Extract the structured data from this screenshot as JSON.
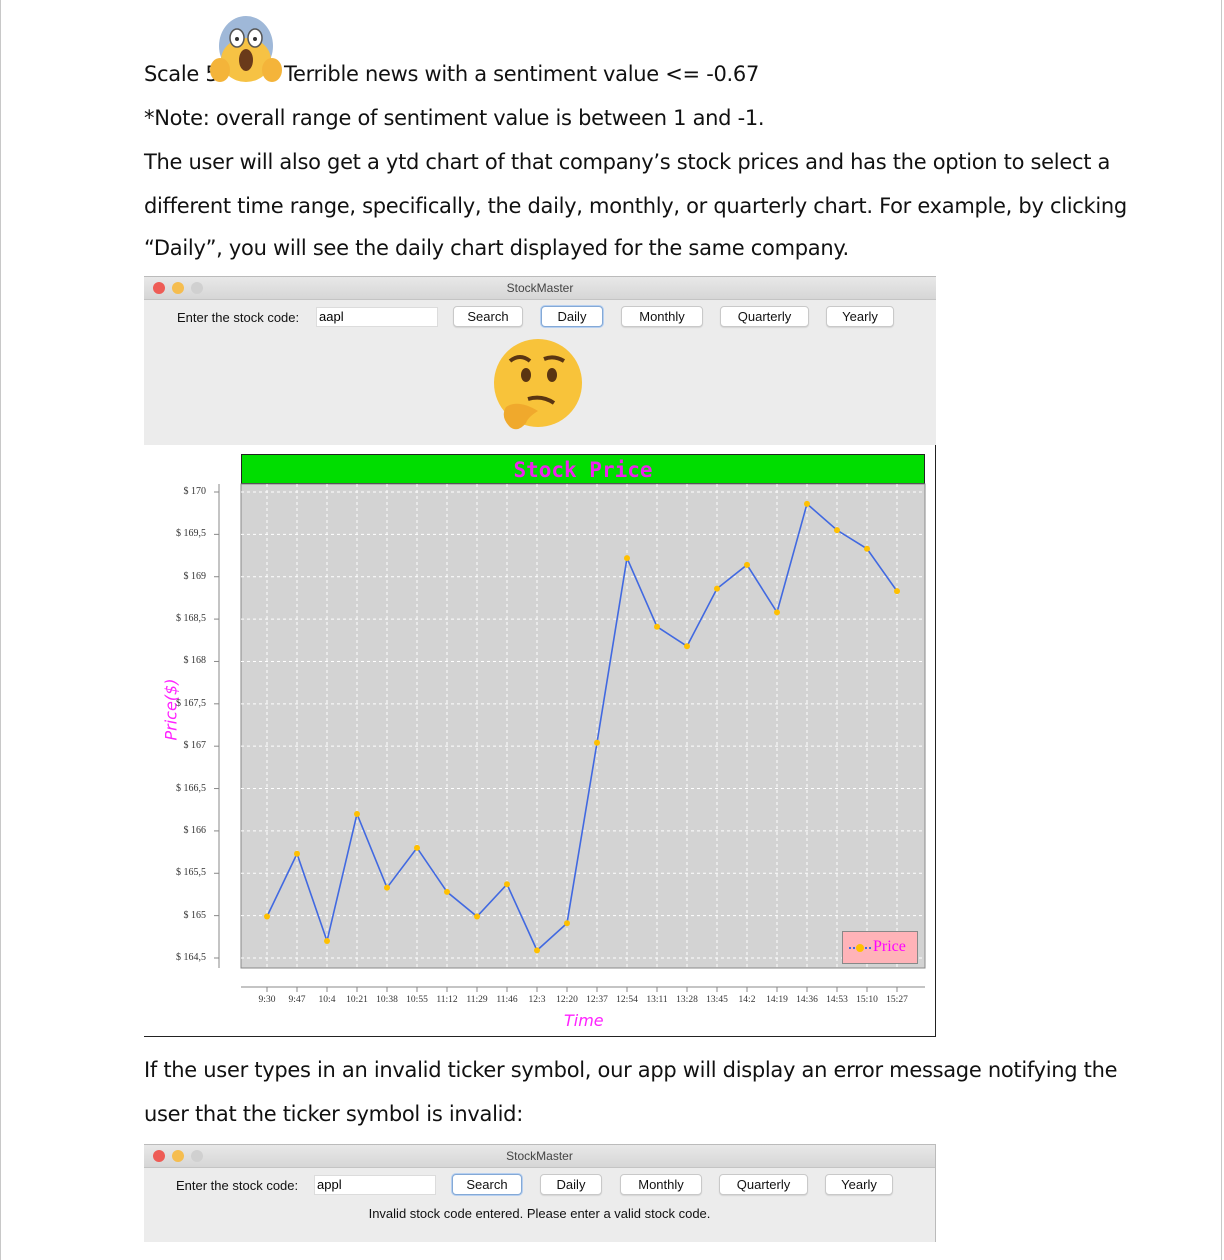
{
  "document": {
    "line1_prefix": "Scale 5",
    "line1_suffix": "Terrible news with a sentiment value <= -0.67",
    "line1_emoji": "face-screaming-in-fear",
    "line2": "*Note: overall range of sentiment value is between 1 and -1.",
    "line3": "The user will also get a ytd chart of that company’s stock prices and has the option to select a",
    "line4": "different time range, specifically, the daily, monthly, or quarterly chart. For example, by clicking",
    "line5": "“Daily”, you will see the daily chart displayed for the same company.",
    "line6": "If the user types in an invalid ticker symbol, our app will display an error message notifying the",
    "line7": "user that the ticker symbol is invalid:"
  },
  "window1": {
    "title": "StockMaster",
    "prompt_label": "Enter the stock code:",
    "stock_code_value": "aapl",
    "buttons": {
      "search": "Search",
      "daily": "Daily",
      "monthly": "Monthly",
      "quarterly": "Quarterly",
      "yearly": "Yearly"
    },
    "focused_button": "Daily",
    "emoji": "thinking-face"
  },
  "window2": {
    "title": "StockMaster",
    "prompt_label": "Enter the stock code:",
    "stock_code_value": "appl",
    "buttons": {
      "search": "Search",
      "daily": "Daily",
      "monthly": "Monthly",
      "quarterly": "Quarterly",
      "yearly": "Yearly"
    },
    "focused_button": "Search",
    "error_message": "Invalid stock code entered. Please enter a valid stock code."
  },
  "colors": {
    "title_bar": "#00dd00",
    "title_text": "#ee22ee",
    "plot_bg": "#d3d3d3",
    "line": "#4169e1",
    "marker": "#ffc000",
    "legend_bg": "#ffb3b8",
    "axis_label": "#ff22ff"
  },
  "chart_data": {
    "type": "line",
    "title": "Stock Price",
    "xlabel": "Time",
    "ylabel": "Price($)",
    "ylim": [
      164.5,
      170
    ],
    "grid": true,
    "legend_position": "bottom-right",
    "yticks": [
      "$ 170",
      "$ 169,5",
      "$ 169",
      "$ 168,5",
      "$ 168",
      "$ 167,5",
      "$ 167",
      "$ 166,5",
      "$ 166",
      "$ 165,5",
      "$ 165",
      "$ 164,5"
    ],
    "ytick_values": [
      170,
      169.5,
      169,
      168.5,
      168,
      167.5,
      167,
      166.5,
      166,
      165.5,
      165,
      164.5
    ],
    "xticks": [
      "9:30",
      "9:47",
      "10:4",
      "10:21",
      "10:38",
      "10:55",
      "11:12",
      "11:29",
      "11:46",
      "12:3",
      "12:20",
      "12:37",
      "12:54",
      "13:11",
      "13:28",
      "13:45",
      "14:2",
      "14:19",
      "14:36",
      "14:53",
      "15:10",
      "15:27"
    ],
    "series": [
      {
        "name": "Price",
        "values": [
          164.99,
          165.73,
          164.7,
          166.2,
          165.33,
          165.8,
          165.28,
          164.99,
          165.37,
          164.59,
          164.91,
          167.04,
          169.22,
          168.41,
          168.18,
          168.86,
          169.14,
          168.58,
          169.86,
          169.55,
          169.33,
          168.83
        ]
      }
    ]
  }
}
